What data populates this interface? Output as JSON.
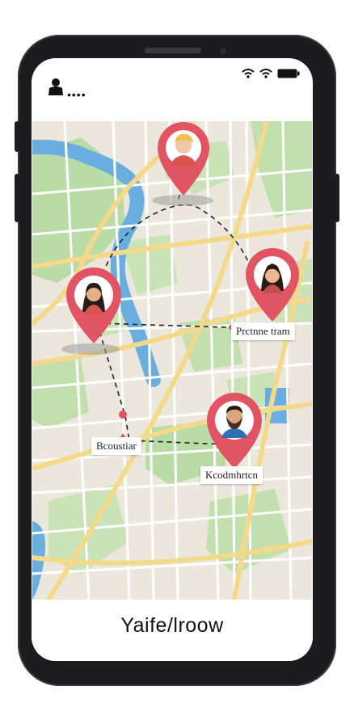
{
  "status_bar": {
    "left_icon": "person-icon",
    "dots": "••••",
    "right_icons": [
      "wifi-icon",
      "wifi-icon",
      "battery-icon"
    ]
  },
  "map": {
    "labels": {
      "right_pin_label": "Prctnne tram",
      "left_lower_label": "Bcoustiar",
      "bottom_pin_label": "Kcodmhrtcn"
    },
    "pins": [
      {
        "name": "pin-top",
        "person": "man-blond-avatar"
      },
      {
        "name": "pin-left",
        "person": "woman-dark-hair-avatar"
      },
      {
        "name": "pin-right",
        "person": "woman-avatar"
      },
      {
        "name": "pin-bottom",
        "person": "bearded-man-avatar"
      }
    ],
    "colors": {
      "pin": "#e05463",
      "water": "#6aaee0",
      "park": "#b9dba6",
      "road_major": "#f4d98a",
      "route": "#222222"
    }
  },
  "footer": {
    "title": "Yaife/lroow"
  }
}
